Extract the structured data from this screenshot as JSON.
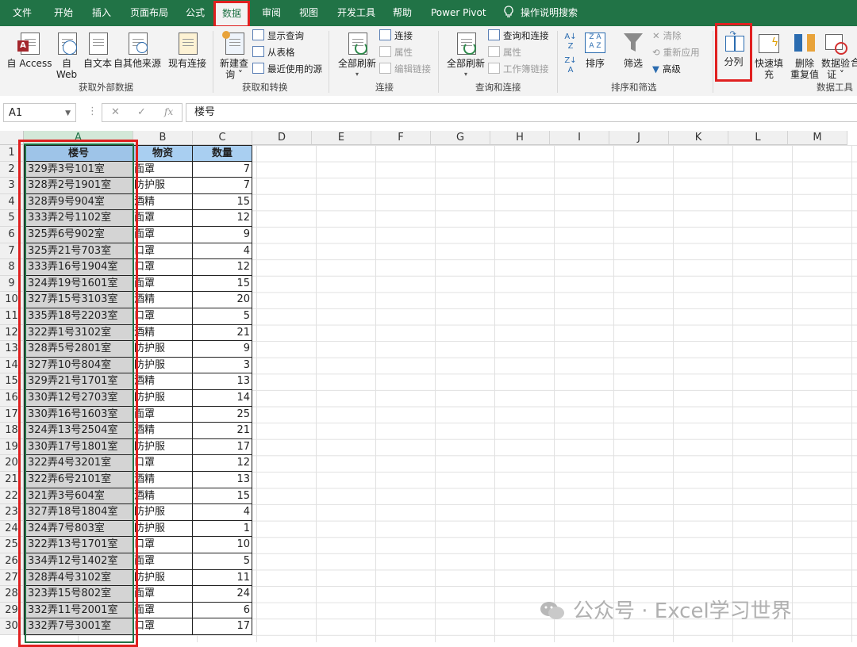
{
  "tabs": [
    {
      "label": "文件",
      "active": false
    },
    {
      "label": "开始",
      "active": false
    },
    {
      "label": "插入",
      "active": false
    },
    {
      "label": "页面布局",
      "active": false
    },
    {
      "label": "公式",
      "active": false
    },
    {
      "label": "数据",
      "active": true
    },
    {
      "label": "审阅",
      "active": false
    },
    {
      "label": "视图",
      "active": false
    },
    {
      "label": "开发工具",
      "active": false
    },
    {
      "label": "帮助",
      "active": false
    },
    {
      "label": "Power Pivot",
      "active": false
    }
  ],
  "tell_me": "操作说明搜索",
  "ribbon": {
    "get_external": {
      "group_label": "获取外部数据",
      "access": "自 Access",
      "web_1": "自",
      "web_2": "Web",
      "text": "自文本",
      "other": "自其他来源",
      "existing": "现有连接"
    },
    "get_transform": {
      "group_label": "获取和转换",
      "new_query_1": "新建查",
      "new_query_2": "询 ˅",
      "show_queries": "显示查询",
      "from_table": "从表格",
      "recent_sources": "最近使用的源"
    },
    "connections": {
      "group_label": "连接",
      "refresh_all": "全部刷新",
      "connections": "连接",
      "properties": "属性",
      "edit_links": "编辑链接"
    },
    "queries_connections": {
      "group_label": "查询和连接",
      "refresh_all": "全部刷新",
      "queries_and_connections": "查询和连接",
      "properties": "属性",
      "workbook_links": "工作簿链接"
    },
    "sort_filter": {
      "group_label": "排序和筛选",
      "sort": "排序",
      "filter": "筛选",
      "clear": "清除",
      "reapply": "重新应用",
      "advanced": "高级"
    },
    "data_tools": {
      "group_label": "数据工具",
      "split": "分列",
      "flash_fill": "快速填充",
      "remove_dup_1": "删除",
      "remove_dup_2": "重复值",
      "validation_1": "数据验",
      "validation_2": "证 ˅",
      "cut_label": "合"
    }
  },
  "formula_bar": {
    "name_box": "A1",
    "fx": "fx",
    "cancel": "✕",
    "enter": "✓",
    "content": "楼号"
  },
  "columns": [
    "A",
    "B",
    "C",
    "D",
    "E",
    "F",
    "G",
    "H",
    "I",
    "J",
    "K",
    "L",
    "M"
  ],
  "rows": [
    "1",
    "2",
    "3",
    "4",
    "5",
    "6",
    "7",
    "8",
    "9",
    "10",
    "11",
    "12",
    "13",
    "14",
    "15",
    "16",
    "17",
    "18",
    "19",
    "20",
    "21",
    "22",
    "23",
    "24",
    "25",
    "26",
    "27",
    "28",
    "29",
    "30"
  ],
  "table": {
    "headers": [
      "楼号",
      "物资",
      "数量"
    ],
    "data": [
      [
        "329弄3号101室",
        "面罩",
        "7"
      ],
      [
        "328弄2号1901室",
        "防护服",
        "7"
      ],
      [
        "328弄9号904室",
        "酒精",
        "15"
      ],
      [
        "333弄2号1102室",
        "面罩",
        "12"
      ],
      [
        "325弄6号902室",
        "面罩",
        "9"
      ],
      [
        "325弄21号703室",
        "口罩",
        "4"
      ],
      [
        "333弄16号1904室",
        "口罩",
        "12"
      ],
      [
        "324弄19号1601室",
        "面罩",
        "15"
      ],
      [
        "327弄15号3103室",
        "酒精",
        "20"
      ],
      [
        "335弄18号2203室",
        "口罩",
        "5"
      ],
      [
        "322弄1号3102室",
        "酒精",
        "21"
      ],
      [
        "328弄5号2801室",
        "防护服",
        "9"
      ],
      [
        "327弄10号804室",
        "防护服",
        "3"
      ],
      [
        "329弄21号1701室",
        "酒精",
        "13"
      ],
      [
        "330弄12号2703室",
        "防护服",
        "14"
      ],
      [
        "330弄16号1603室",
        "面罩",
        "25"
      ],
      [
        "324弄13号2504室",
        "酒精",
        "21"
      ],
      [
        "330弄17号1801室",
        "防护服",
        "17"
      ],
      [
        "322弄4号3201室",
        "口罩",
        "12"
      ],
      [
        "322弄6号2101室",
        "酒精",
        "13"
      ],
      [
        "321弄3号604室",
        "酒精",
        "15"
      ],
      [
        "327弄18号1804室",
        "防护服",
        "4"
      ],
      [
        "324弄7号803室",
        "防护服",
        "1"
      ],
      [
        "322弄13号1701室",
        "口罩",
        "10"
      ],
      [
        "334弄12号1402室",
        "面罩",
        "5"
      ],
      [
        "328弄4号3102室",
        "防护服",
        "11"
      ],
      [
        "323弄15号802室",
        "面罩",
        "24"
      ],
      [
        "332弄11号2001室",
        "面罩",
        "6"
      ],
      [
        "332弄7号3001室",
        "口罩",
        "17"
      ]
    ]
  },
  "watermark": "公众号 · Excel学习世界",
  "accent_color": "#217346",
  "highlight_color": "#e02020"
}
